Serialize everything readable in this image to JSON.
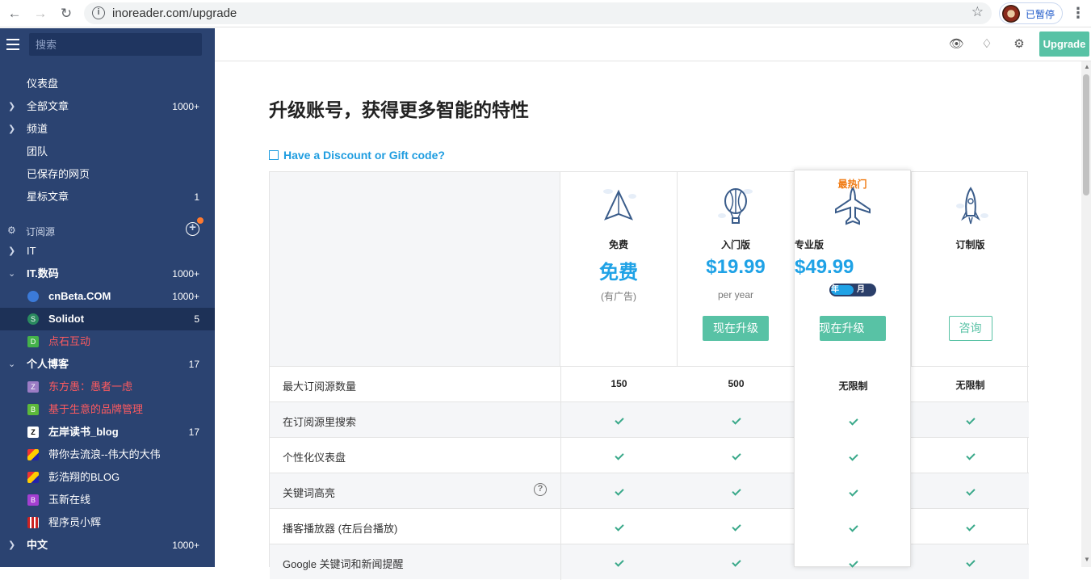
{
  "browser": {
    "url": "inoreader.com/upgrade",
    "profile_label": "已暂停"
  },
  "sidebar": {
    "search_placeholder": "搜索",
    "nav": [
      {
        "label": "仪表盘",
        "count": ""
      },
      {
        "label": "全部文章",
        "count": "1000+"
      },
      {
        "label": "频道",
        "count": ""
      },
      {
        "label": "团队",
        "count": ""
      },
      {
        "label": "已保存的网页",
        "count": ""
      },
      {
        "label": "星标文章",
        "count": "1"
      }
    ],
    "section_label": "订阅源",
    "feeds": [
      {
        "label": "IT",
        "count": ""
      },
      {
        "label": "IT.数码",
        "count": "1000+"
      },
      {
        "label": "cnBeta.COM",
        "count": "1000+"
      },
      {
        "label": "Solidot",
        "count": "5"
      },
      {
        "label": "点石互动",
        "count": ""
      },
      {
        "label": "个人博客",
        "count": "17"
      },
      {
        "label": "东方愚：愚者一虑",
        "count": ""
      },
      {
        "label": "基于生意的品牌管理",
        "count": ""
      },
      {
        "label": "左岸读书_blog",
        "count": "17"
      },
      {
        "label": "带你去流浪--伟大的大伟",
        "count": ""
      },
      {
        "label": "彭浩翔的BLOG",
        "count": ""
      },
      {
        "label": "玉新在线",
        "count": ""
      },
      {
        "label": "程序员小辉",
        "count": ""
      },
      {
        "label": "中文",
        "count": "1000+"
      }
    ],
    "feed_icon_letters": {
      "solidot": "S",
      "dianshi": "D",
      "dongfang": "Z",
      "jiyu": "B",
      "yuxin": "B"
    }
  },
  "topbar": {
    "upgrade_label": "Upgrade"
  },
  "main": {
    "title": "升级账号，获得更多智能的特性",
    "discount_link": "Have a Discount or Gift code?",
    "popular_label": "最热门",
    "plans": [
      {
        "name": "免费",
        "price": "免费",
        "sub": "(有广告)",
        "button": ""
      },
      {
        "name": "入门版",
        "price": "$19.99",
        "sub": "per year",
        "button": "现在升级"
      },
      {
        "name": "专业版",
        "price": "$49.99",
        "sub": "",
        "button": "现在升级"
      },
      {
        "name": "订制版",
        "price": "",
        "sub": "",
        "button": "咨询"
      }
    ],
    "billing_toggle": {
      "year": "年",
      "month": "月"
    },
    "features": [
      {
        "name": "最大订阅源数量",
        "values": [
          "150",
          "500",
          "无限制",
          "无限制"
        ]
      },
      {
        "name": "在订阅源里搜索",
        "values": [
          "check",
          "check",
          "check",
          "check"
        ]
      },
      {
        "name": "个性化仪表盘",
        "values": [
          "check",
          "check",
          "check",
          "check"
        ]
      },
      {
        "name": "关键词高亮",
        "values": [
          "check",
          "check",
          "check",
          "check"
        ]
      },
      {
        "name": "播客播放器 (在后台播放)",
        "values": [
          "check",
          "check",
          "check",
          "check"
        ]
      },
      {
        "name": "Google 关键词和新闻提醒",
        "values": [
          "check",
          "check",
          "check",
          "check"
        ]
      }
    ]
  },
  "colors": {
    "sidebar_bg": "#2b4371",
    "accent_green": "#58c2a5",
    "price_blue": "#1fa2e6",
    "popular_orange": "#f07a12"
  }
}
